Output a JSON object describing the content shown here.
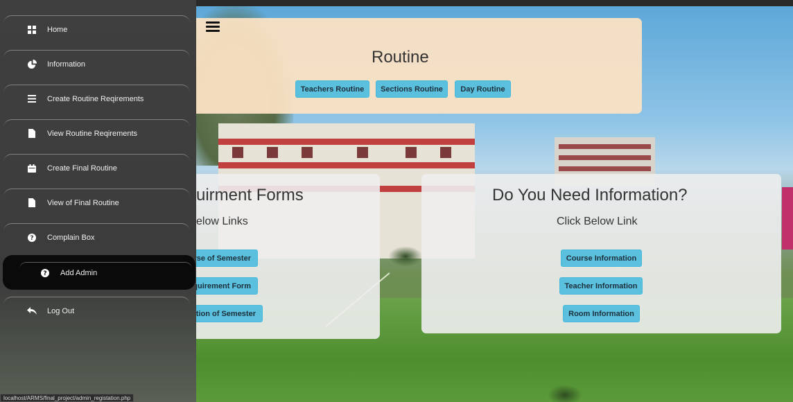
{
  "sidebar": {
    "items": [
      {
        "label": "Home",
        "icon": "grid-icon"
      },
      {
        "label": "Information",
        "icon": "pie-chart-icon"
      },
      {
        "label": "Create Routine Reqirements",
        "icon": "list-icon"
      },
      {
        "label": "View Routine Reqirements",
        "icon": "file-icon"
      },
      {
        "label": "Create Final Routine",
        "icon": "calendar-icon"
      },
      {
        "label": "View of Final Routine",
        "icon": "file-icon"
      },
      {
        "label": "Complain Box",
        "icon": "question-circle-icon"
      },
      {
        "label": "Add Admin",
        "icon": "question-circle-icon",
        "active": true
      },
      {
        "label": "Log Out",
        "icon": "reply-icon"
      }
    ],
    "status_url": "localhost/ARMS/final_project/admin_registation.php"
  },
  "routine": {
    "title": "Routine",
    "buttons": [
      "Teachers Routine",
      "Sections Routine",
      "Day Routine"
    ]
  },
  "requirement_card": {
    "title": "uirment Forms",
    "subtitle": "elow Links",
    "buttons": [
      "rse of Semester",
      "quirement Form",
      "ation of Semester"
    ]
  },
  "info_card": {
    "title": "Do You Need Information?",
    "subtitle": "Click Below Link",
    "buttons": [
      "Course Information",
      "Teacher Information",
      "Room Information"
    ]
  },
  "colors": {
    "sidebar_bg": "#3c3c3c",
    "active_item_bg": "#0a0a0a",
    "button_bg": "#5bc0de",
    "routine_card_bg": "#fae1c3"
  }
}
